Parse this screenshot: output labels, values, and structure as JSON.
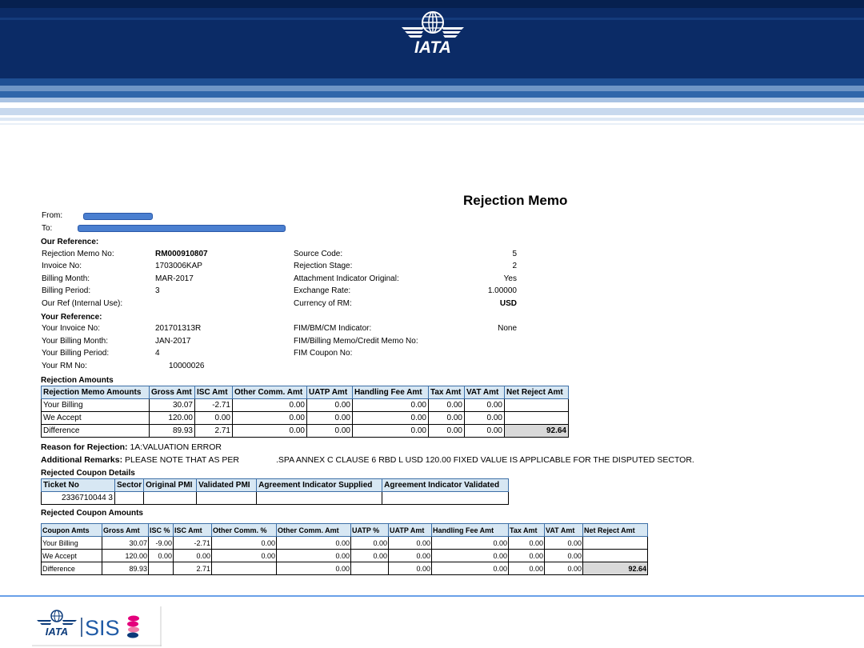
{
  "header": {
    "logo_text": "IATA"
  },
  "document": {
    "title": "Rejection Memo"
  },
  "parties": {
    "from_label": "From:",
    "to_label": "To:"
  },
  "our_reference": {
    "heading": "Our Reference:",
    "left": [
      {
        "label": "Rejection Memo No:",
        "value": "RM000910807"
      },
      {
        "label": "Invoice No:",
        "value": "1703006KAP"
      },
      {
        "label": "Billing Month:",
        "value": "MAR-2017"
      },
      {
        "label": "Billing Period:",
        "value": "3"
      },
      {
        "label": "Our Ref (Internal Use):",
        "value": ""
      }
    ],
    "right": [
      {
        "label": "Source Code:",
        "value": "5"
      },
      {
        "label": "Rejection Stage:",
        "value": "2"
      },
      {
        "label": "Attachment Indicator Original:",
        "value": "Yes"
      },
      {
        "label": "Exchange Rate:",
        "value": "1.00000"
      },
      {
        "label": "Currency of RM:",
        "value": "USD"
      }
    ]
  },
  "your_reference": {
    "heading": "Your Reference:",
    "left": [
      {
        "label": "Your Invoice No:",
        "value": "201701313R"
      },
      {
        "label": "Your Billing Month:",
        "value": "JAN-2017"
      },
      {
        "label": "Your Billing Period:",
        "value": "4"
      },
      {
        "label": "Your RM No:",
        "value": "10000026"
      }
    ],
    "right": [
      {
        "label": "FIM/BM/CM Indicator:",
        "value": "None"
      },
      {
        "label": "FIM/Billing Memo/Credit Memo No:",
        "value": ""
      },
      {
        "label": "FIM Coupon No:",
        "value": ""
      }
    ]
  },
  "rejection_amounts": {
    "heading": "Rejection Amounts",
    "columns": [
      "Rejection Memo Amounts",
      "Gross Amt",
      "ISC Amt",
      "Other Comm. Amt",
      "UATP Amt",
      "Handling Fee Amt",
      "Tax Amt",
      "VAT Amt",
      "Net Reject Amt"
    ],
    "rows": [
      [
        "Your Billing",
        "30.07",
        "-2.71",
        "0.00",
        "0.00",
        "0.00",
        "0.00",
        "0.00",
        ""
      ],
      [
        "We Accept",
        "120.00",
        "0.00",
        "0.00",
        "0.00",
        "0.00",
        "0.00",
        "0.00",
        ""
      ],
      [
        "Difference",
        "89.93",
        "2.71",
        "0.00",
        "0.00",
        "0.00",
        "0.00",
        "0.00",
        "92.64"
      ]
    ]
  },
  "reason": {
    "label": "Reason for Rejection:",
    "value": "1A:VALUATION ERROR",
    "remarks_label": "Additional Remarks:",
    "remarks_start": "PLEASE NOTE THAT AS PER",
    "remarks_end": ".SPA ANNEX C CLAUSE 6 RBD L USD 120.00 FIXED VALUE IS APPLICABLE FOR THE DISPUTED SECTOR."
  },
  "coupon_details": {
    "heading": "Rejected Coupon Details",
    "columns": [
      "Ticket No",
      "Sector",
      "Original PMI",
      "Validated PMI",
      "Agreement Indicator Supplied",
      "Agreement Indicator Validated"
    ],
    "rows": [
      [
        "2336710044 3",
        "",
        "",
        "",
        "",
        ""
      ]
    ]
  },
  "coupon_amounts": {
    "heading": "Rejected Coupon Amounts",
    "columns": [
      "Coupon Amts",
      "Gross Amt",
      "ISC %",
      "ISC Amt",
      "Other Comm. %",
      "Other Comm. Amt",
      "UATP %",
      "UATP Amt",
      "Handling Fee Amt",
      "Tax Amt",
      "VAT Amt",
      "Net Reject Amt"
    ],
    "rows": [
      [
        "Your Billing",
        "30.07",
        "-9.00",
        "-2.71",
        "0.00",
        "0.00",
        "0.00",
        "0.00",
        "0.00",
        "0.00",
        "0.00",
        ""
      ],
      [
        "We Accept",
        "120.00",
        "0.00",
        "0.00",
        "0.00",
        "0.00",
        "0.00",
        "0.00",
        "0.00",
        "0.00",
        "0.00",
        ""
      ],
      [
        "Difference",
        "89.93",
        "",
        "2.71",
        "",
        "0.00",
        "",
        "0.00",
        "0.00",
        "0.00",
        "0.00",
        "92.64"
      ]
    ]
  },
  "footer": {
    "brand_iata": "IATA",
    "brand_sis": "SIS"
  },
  "colors": {
    "banner_dark": "#0a2d6b",
    "banner_mid": "#1e4f95",
    "banner_light": "#bcd2ec",
    "accent": "#4a7fd0"
  }
}
